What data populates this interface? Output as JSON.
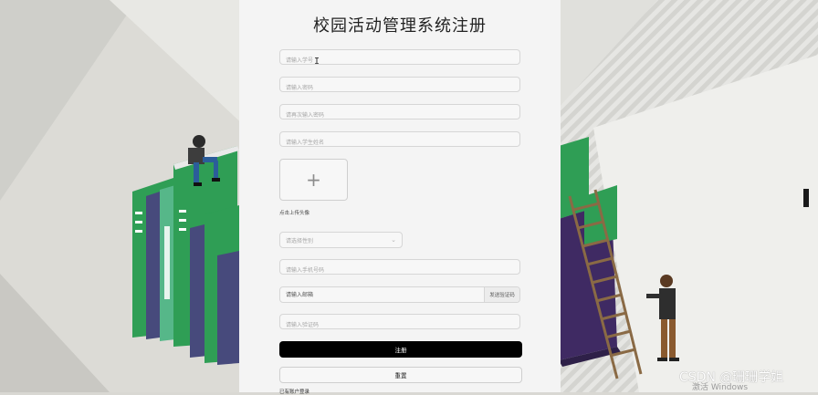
{
  "form": {
    "title": "校园活动管理系统注册",
    "student_id_placeholder": "请输入学号",
    "password_placeholder": "请输入密码",
    "confirm_password_placeholder": "请再次输入密码",
    "name_placeholder": "请输入学生姓名",
    "upload_plus": "+",
    "upload_label": "点击上传头像",
    "gender_placeholder": "请选择性别",
    "gender_chevron": "⌄",
    "phone_placeholder": "请输入手机号码",
    "email_placeholder": "请输入邮箱",
    "send_code_label": "发送验证码",
    "code_placeholder": "请输入验证码",
    "register_label": "注册",
    "reset_label": "重置",
    "login_link": "已有账户登录"
  },
  "overlay": {
    "watermark": "CSDN @珊珊学姐",
    "activate": "激活 Windows"
  },
  "colors": {
    "panel_bg": "#f4f4f4",
    "button_primary": "#000000",
    "book_green": "#2f9e55",
    "book_purple": "#3f2a63"
  }
}
